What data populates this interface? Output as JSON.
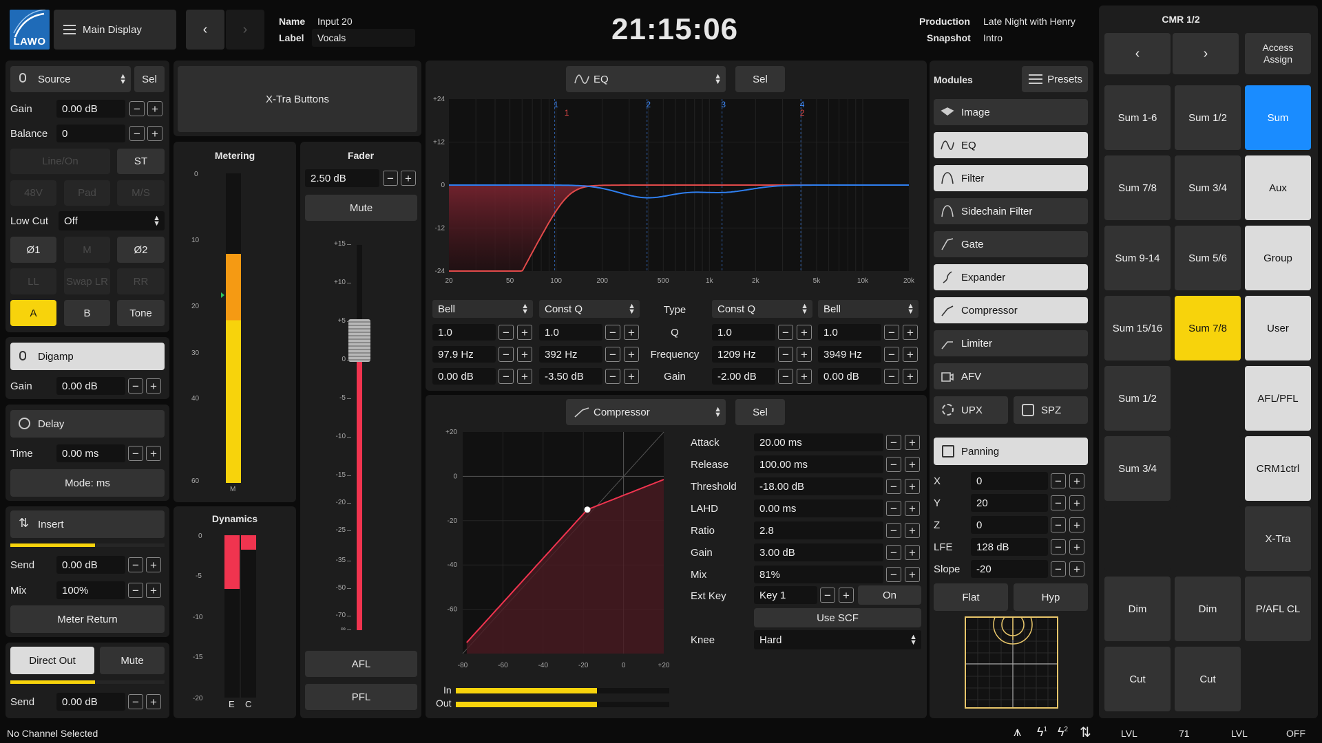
{
  "header": {
    "logo": "LAWO",
    "main_display": "Main Display",
    "name_label": "Name",
    "name_value": "Input 20",
    "label_label": "Label",
    "label_value": "Vocals",
    "clock": "21:15:06",
    "production_label": "Production",
    "production_value": "Late Night with Henry",
    "snapshot_label": "Snapshot",
    "snapshot_value": "Intro",
    "cmr_title": "CMR 1/2",
    "access_assign": "Access\nAssign"
  },
  "source": {
    "label": "Source",
    "sel": "Sel",
    "gain_label": "Gain",
    "gain_value": "0.00 dB",
    "balance_label": "Balance",
    "balance_value": "0",
    "line_on": "Line/On",
    "st": "ST",
    "p48v": "48V",
    "pad": "Pad",
    "ms": "M/S",
    "lowcut_label": "Low Cut",
    "lowcut_value": "Off",
    "phi1": "Ø1",
    "m": "M",
    "phi2": "Ø2",
    "ll": "LL",
    "swap": "Swap LR",
    "rr": "RR",
    "a": "A",
    "b": "B",
    "tone": "Tone"
  },
  "digamp": {
    "label": "Digamp",
    "gain_label": "Gain",
    "gain_value": "0.00 dB"
  },
  "delay": {
    "label": "Delay",
    "time_label": "Time",
    "time_value": "0.00 ms",
    "mode": "Mode: ms"
  },
  "insert": {
    "label": "Insert",
    "send_label": "Send",
    "send_value": "0.00 dB",
    "mix_label": "Mix",
    "mix_value": "100%",
    "meter_return": "Meter Return",
    "send_level": 0.55
  },
  "direct": {
    "direct_out": "Direct Out",
    "mute": "Mute",
    "send_label": "Send",
    "send_value": "0.00 dB",
    "send_level": 0.55
  },
  "xtra": {
    "label": "X-Tra Buttons"
  },
  "metering": {
    "title": "Metering",
    "ticks": [
      "0",
      "10",
      "20",
      "30",
      "40",
      "60"
    ],
    "foot": "M",
    "level": 0.74,
    "peak_level": 0.6
  },
  "dynamics": {
    "title": "Dynamics",
    "ticks": [
      "0",
      "-5",
      "-10",
      "-15",
      "-20"
    ],
    "e_label": "E",
    "c_label": "C",
    "e_level": 0.33,
    "c_level": 0.09
  },
  "fader": {
    "title": "Fader",
    "value": "2.50 dB",
    "mute": "Mute",
    "afl": "AFL",
    "pfl": "PFL",
    "ticks": [
      "+15",
      "+10",
      "+5",
      "0",
      "-5",
      "-10",
      "-15",
      "-20",
      "-25",
      "-35",
      "-50",
      "-70",
      "∞"
    ],
    "position_db": 2.5
  },
  "eq": {
    "title": "EQ",
    "sel": "Sel",
    "y_ticks": [
      "+24",
      "+12",
      "0",
      "-12",
      "-24"
    ],
    "x_ticks": [
      "20",
      "50",
      "100",
      "200",
      "500",
      "1k",
      "2k",
      "5k",
      "10k",
      "20k"
    ],
    "band_markers": [
      "1",
      "2",
      "3",
      "4"
    ],
    "band_markers_red": [
      "1",
      "2"
    ],
    "bands": [
      {
        "type": "Bell",
        "q": "1.0",
        "freq": "97.9 Hz",
        "gain": "0.00 dB"
      },
      {
        "type": "Const Q",
        "q": "1.0",
        "freq": "392 Hz",
        "gain": "-3.50 dB"
      },
      {
        "type": "Const Q",
        "q": "1.0",
        "freq": "1209 Hz",
        "gain": "-2.00 dB"
      },
      {
        "type": "Bell",
        "q": "1.0",
        "freq": "3949 Hz",
        "gain": "0.00 dB"
      }
    ],
    "row_labels": {
      "type": "Type",
      "q": "Q",
      "freq": "Frequency",
      "gain": "Gain"
    }
  },
  "compressor": {
    "title": "Compressor",
    "sel": "Sel",
    "y_ticks": [
      "+20",
      "0",
      "-20",
      "-40",
      "-60"
    ],
    "x_ticks": [
      "-80",
      "-60",
      "-40",
      "-20",
      "0",
      "+20"
    ],
    "params": [
      {
        "label": "Attack",
        "value": "20.00 ms"
      },
      {
        "label": "Release",
        "value": "100.00 ms"
      },
      {
        "label": "Threshold",
        "value": "-18.00 dB"
      },
      {
        "label": "LAHD",
        "value": "0.00 ms"
      },
      {
        "label": "Ratio",
        "value": "2.8"
      },
      {
        "label": "Gain",
        "value": "3.00 dB"
      },
      {
        "label": "Mix",
        "value": "81%"
      }
    ],
    "extkey_label": "Ext Key",
    "extkey_value": "Key 1",
    "on": "On",
    "use_scf": "Use SCF",
    "knee_label": "Knee",
    "knee_value": "Hard",
    "in_label": "In",
    "out_label": "Out",
    "in_level": 0.66,
    "out_level": 0.66
  },
  "modules": {
    "title": "Modules",
    "presets": "Presets",
    "items": [
      {
        "label": "Image",
        "on": false
      },
      {
        "label": "EQ",
        "on": true
      },
      {
        "label": "Filter",
        "on": true
      },
      {
        "label": "Sidechain Filter",
        "on": false
      },
      {
        "label": "Gate",
        "on": false
      },
      {
        "label": "Expander",
        "on": true
      },
      {
        "label": "Compressor",
        "on": true
      },
      {
        "label": "Limiter",
        "on": false
      },
      {
        "label": "AFV",
        "on": false
      }
    ],
    "upx": "UPX",
    "spz": "SPZ",
    "panning": "Panning",
    "pan": [
      {
        "label": "X",
        "value": "0"
      },
      {
        "label": "Y",
        "value": "20"
      },
      {
        "label": "Z",
        "value": "0"
      },
      {
        "label": "LFE",
        "value": "128 dB"
      },
      {
        "label": "Slope",
        "value": "-20"
      }
    ],
    "flat": "Flat",
    "hyp": "Hyp"
  },
  "cmr": {
    "buttons": [
      [
        "Sum 1-6",
        "Sum 1/2",
        "Sum"
      ],
      [
        "Sum 7/8",
        "Sum 3/4",
        "Aux"
      ],
      [
        "Sum 9-14",
        "Sum 5/6",
        "Group"
      ],
      [
        "Sum 15/16",
        "Sum 7/8",
        "User"
      ],
      [
        "Sum 1/2",
        "",
        "AFL/PFL"
      ],
      [
        "Sum 3/4",
        "",
        "CRM1ctrl"
      ],
      [
        "",
        "",
        "X-Tra"
      ],
      [
        "Dim",
        "Dim",
        "P/AFL CL"
      ],
      [
        "Cut",
        "Cut",
        ""
      ]
    ]
  },
  "status": {
    "left": "No Channel Selected",
    "lvl1": "LVL",
    "num": "71",
    "lvl2": "LVL",
    "off": "OFF",
    "icon1_sup": "1",
    "icon2_sup": "2"
  },
  "colors": {
    "yellow": "#f7d30c",
    "orange": "#f59a13",
    "red": "#f0344f",
    "blue": "#1a8cff",
    "eq_blue": "#2f7ff0",
    "eq_red": "#e24a4a"
  }
}
